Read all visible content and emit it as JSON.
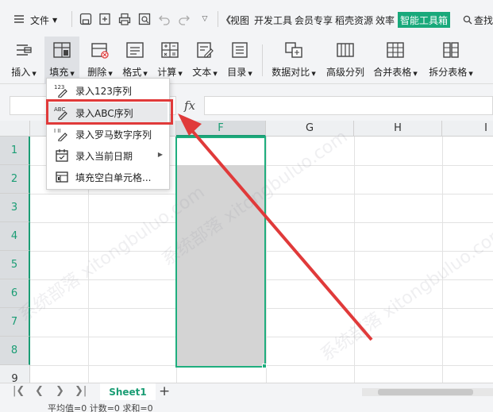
{
  "menubar": {
    "file_label": "文件",
    "tabs": [
      "视图",
      "开发工具",
      "会员专享",
      "稻壳资源",
      "效率"
    ],
    "highlighted_tab": "智能工具箱",
    "search_label": "查找"
  },
  "ribbon": {
    "buttons": [
      {
        "label": "插入"
      },
      {
        "label": "填充"
      },
      {
        "label": "删除"
      },
      {
        "label": "格式"
      },
      {
        "label": "计算"
      },
      {
        "label": "文本"
      },
      {
        "label": "目录"
      },
      {
        "label": "数据对比"
      },
      {
        "label": "高级分列"
      },
      {
        "label": "合并表格"
      },
      {
        "label": "拆分表格"
      }
    ]
  },
  "formula_bar": {
    "fx_label": "fx"
  },
  "fill_menu": {
    "items": [
      {
        "label": "录入123序列",
        "icon": "sequence-123-icon"
      },
      {
        "label": "录入ABC序列",
        "icon": "sequence-abc-icon"
      },
      {
        "label": "录入罗马数字序列",
        "icon": "roman-numeral-icon"
      },
      {
        "label": "录入当前日期",
        "icon": "calendar-icon"
      },
      {
        "label": "填充空白单元格...",
        "icon": "fill-blank-icon"
      }
    ]
  },
  "grid": {
    "columns": [
      "F",
      "G",
      "H",
      "I"
    ],
    "rows": [
      "1",
      "2",
      "3",
      "4",
      "5",
      "6",
      "7",
      "8",
      "9"
    ],
    "selected_column": "F"
  },
  "sheets": {
    "tabs": [
      "Sheet1"
    ]
  },
  "statusbar": {
    "text": "平均值=0  计数=0  求和=0"
  },
  "watermark": {
    "text": "系统部落 xitongbuluo.com"
  },
  "colors": {
    "accent": "#1a9d74",
    "annotation": "#e03a3a"
  }
}
